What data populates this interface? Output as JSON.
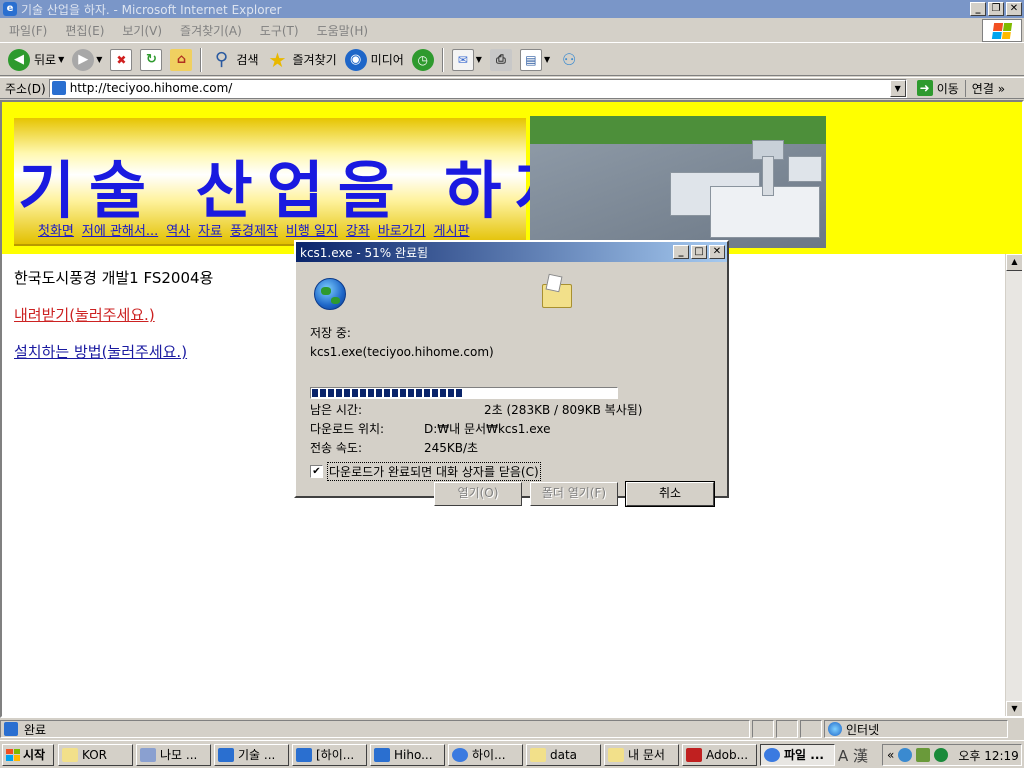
{
  "window": {
    "title": "기술 산업을 하자. - Microsoft Internet Explorer",
    "controls": [
      "_",
      "❐",
      "✕"
    ]
  },
  "menu": [
    "파일(F)",
    "편집(E)",
    "보기(V)",
    "즐겨찾기(A)",
    "도구(T)",
    "도움말(H)"
  ],
  "toolbar": {
    "back": "뒤로",
    "search": "검색",
    "favorites": "즐겨찾기",
    "media": "미디어"
  },
  "address": {
    "label": "주소(D)",
    "url": "http://teciyoo.hihome.com/",
    "go": "이동",
    "links": "연결"
  },
  "banner": {
    "title": "기술 산업을 하자",
    "nav": [
      "첫화면",
      "저에 관해서...",
      "역사",
      "자료",
      "풍경제작",
      "비행 일지",
      "강좌",
      "바로가기",
      "게시판"
    ]
  },
  "page": {
    "heading": "한국도시풍경 개발1 FS2004용",
    "download_link": "내려받기(눌러주세요.)",
    "install_link": "설치하는 방법(눌러주세요.)"
  },
  "dialog": {
    "title": "kcs1.exe - 51% 완료됨",
    "saving_label": "저장 중:",
    "saving_file": "kcs1.exe(teciyoo.hihome.com)",
    "progress_fraction": 0.51,
    "time_left_label": "남은 시간:",
    "time_left_value": "2초 (283KB / 809KB 복사됨)",
    "location_label": "다운로드 위치:",
    "location_value": "D:₩내 문서₩kcs1.exe",
    "rate_label": "전송 속도:",
    "rate_value": "245KB/초",
    "close_checkbox_label": "다운로드가 완료되면 대화 상자를 닫음(C)",
    "close_checkbox_checked": true,
    "open_button": "열기(O)",
    "open_folder_button": "폴더 열기(F)",
    "cancel_button": "취소"
  },
  "status": {
    "text": "완료",
    "zone": "인터넷"
  },
  "taskbar": {
    "start": "시작",
    "tasks": [
      "KOR",
      "나모 ...",
      "기술 ...",
      "[하이...",
      "Hiho...",
      "하이...",
      "data",
      "내 문서",
      "Adob...",
      "파일 ..."
    ],
    "clock": "오후 12:19",
    "ime": "A 漢"
  },
  "colors": {
    "page_background": "#ffff00",
    "banner_title": "#1a1ae0",
    "link_red": "#cc2222",
    "link_blue": "#1a1aa0",
    "progress": "#0a246a"
  }
}
